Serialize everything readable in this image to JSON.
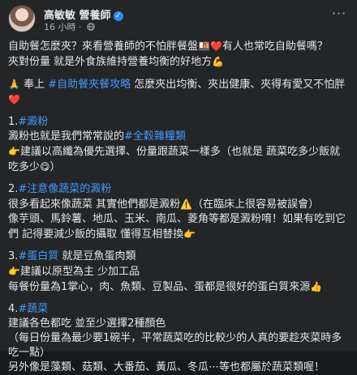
{
  "post": {
    "author": "高敏敏 營養師",
    "timestamp": "16 小時",
    "privacy_icon": "globe-icon",
    "more_icon": "ellipsis-icon",
    "verified_icon": "verified-badge-icon"
  },
  "colors": {
    "background": "#242526",
    "text": "#e4e6eb",
    "hashtag": "#4599ff",
    "secondary": "#b0b3b8",
    "verified": "#2d88ff"
  },
  "body": {
    "intro1_a": "自助餐怎麼夾？來看營養師的不怕胖餐盤",
    "intro1_emoji1": "🍱",
    "intro1_emoji2": "❤️",
    "intro1_b": "有人也常吃自助餐嗎？",
    "intro2": "夾對份量 就是外食族維持營養均衡的好地方",
    "intro2_emoji": "💪",
    "p2_emoji": "🙏",
    "p2_a": "奉上",
    "p2_tag": "#自助餐夾餐攻略",
    "p2_b": "怎麼夾出均衡、夾出健康、夾得有愛又不怕胖",
    "p2_emoji2": "❤️",
    "s1_title": "1.",
    "s1_tag": "#澱粉",
    "s1_l1_a": "澱粉也就是我們常常說的",
    "s1_l1_tag": "#全穀雜糧類",
    "s1_l2_emoji": "👉",
    "s1_l2": "建議以高纖為優先選擇、份量跟蔬菜一樣多（也就是 蔬菜吃多少飯就吃多少",
    "s1_l2_emoji2": "😋",
    "s1_l2_end": "）",
    "s2_num": "2.",
    "s2_tag": "#注意像蔬菜的澱粉",
    "s2_l1": "很多看起來像蔬菜 其實他們都是澱粉",
    "s2_l1_emoji": "⚠️",
    "s2_l1_b": "（在臨床上很容易被誤會）",
    "s2_l2": "像芋頭、馬鈴薯、地瓜、玉米、南瓜、菱角等都是澱粉唷！如果有吃到它們 記得要減少飯的攝取 懂得互相替換",
    "s2_l2_emoji": "👉",
    "s3_num": "3.",
    "s3_tag": "#蛋白質",
    "s3_title_b": "就是豆魚蛋肉類",
    "s3_l1_emoji": "👉",
    "s3_l1": "建議以原型為主 少加工品",
    "s3_l2": "每餐份量為1掌心，肉、魚類、豆製品、蛋都是很好的蛋白質來源",
    "s3_l2_emoji": "👍",
    "s4_num": "4.",
    "s4_tag": "#蔬菜",
    "s4_l1": "建議各色都吃 並至少選擇2種顏色",
    "s4_l2": "（每日份量為最少要1碗半，平常蔬菜吃的比較少的人真的要趁夾菜時多吃一點）",
    "s4_l3": "另外像是藻類、菇類、大番茄、黃瓜、冬瓜⋯等也都屬於蔬菜類喔！"
  }
}
